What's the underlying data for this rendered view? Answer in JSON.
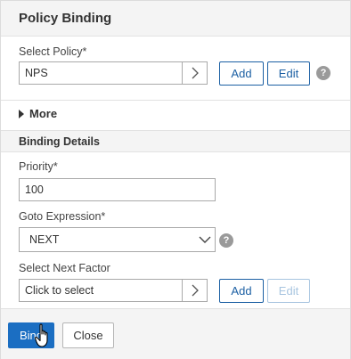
{
  "header": {
    "title": "Policy Binding"
  },
  "policy": {
    "label": "Select Policy*",
    "value": "NPS",
    "add_label": "Add",
    "edit_label": "Edit",
    "help_glyph": "?"
  },
  "more": {
    "label": "More"
  },
  "binding_details": {
    "title": "Binding Details",
    "priority_label": "Priority*",
    "priority_value": "100",
    "goto_label": "Goto Expression*",
    "goto_value": "NEXT",
    "goto_help_glyph": "?"
  },
  "next_factor": {
    "label": "Select Next Factor",
    "placeholder": "Click to select",
    "add_label": "Add",
    "edit_label": "Edit"
  },
  "footer": {
    "bind_label": "Bind",
    "close_label": "Close"
  },
  "colors": {
    "accent": "#1b6ec2",
    "button_outline": "#1b5fa3",
    "disabled": "#a8c5e0",
    "header_bg": "#f4f4f4"
  },
  "icons": {
    "picker_arrow": "chevron-right-icon",
    "dropdown": "chevron-down-icon",
    "expand": "caret-right-icon",
    "help": "help-icon",
    "cursor": "hand-cursor-icon"
  }
}
